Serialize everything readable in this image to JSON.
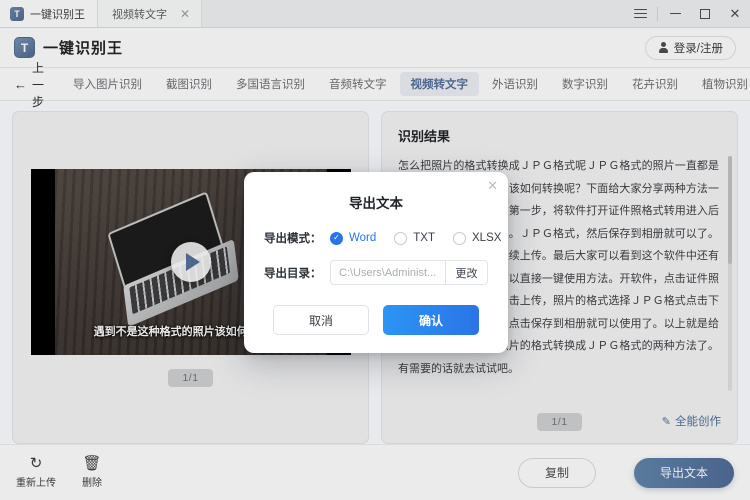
{
  "titlebar": {
    "app_name": "一键识别王",
    "logo_glyph": "T",
    "tab_label": "视频转文字",
    "tab_close": "✕",
    "menu_icon": "hamburger-menu-icon",
    "minimize_icon": "minimize-icon",
    "maximize_icon": "maximize-icon",
    "close_label": "✕"
  },
  "header": {
    "brand_name": "一键识别王",
    "logo_glyph": "T",
    "login_label": "登录/注册",
    "user_icon": "user-icon"
  },
  "nav": {
    "back_label": "上一步",
    "back_arrow": "←",
    "items": [
      {
        "label": "导入图片识别",
        "active": false
      },
      {
        "label": "截图识别",
        "active": false
      },
      {
        "label": "多国语言识别",
        "active": false
      },
      {
        "label": "音频转文字",
        "active": false
      },
      {
        "label": "视频转文字",
        "active": true
      },
      {
        "label": "外语识别",
        "active": false
      },
      {
        "label": "数字识别",
        "active": false
      },
      {
        "label": "花卉识别",
        "active": false
      },
      {
        "label": "植物识别",
        "active": false
      }
    ],
    "more_icon": "chevron-down-icon"
  },
  "preview": {
    "subtitle": "遇到不是这种格式的照片该如何转换呢?",
    "play_icon": "play-icon",
    "pager": "1/1"
  },
  "result": {
    "title": "识别结果",
    "text": "怎么把照片的格式转换成ＪＰＧ格式呢ＪＰＧ格式的照片一直都是我们最常使用的照片，该如何转换呢？下面给大家分享两种方法一证件照全能管家ＡＰＰ第一步，将软件打开证件照格式转用进入后就可以把照片添加进来。ＪＰＧ格式，然后保存到相册就可以了。想要继续转换的点击继续上传。最后大家可以看到这个软件中还有很多，大家需要的话可以直接一键使用方法。开软件，点击证件照格式转换。进入后，点击上传，照片的格式选择ＪＰＧ格式点击下一步就可以转换成功，点击保存到相册就可以使用了。以上就是给大家分享的，如何将照片的格式转换成ＪＰＧ格式的两种方法了。有需要的话就去试试吧。",
    "pager": "1/1",
    "create_label": "全能创作",
    "create_icon": "pen-icon"
  },
  "bottombar": {
    "reupload_label": "重新上传",
    "reupload_icon": "refresh-icon",
    "delete_label": "删除",
    "delete_icon": "trash-icon",
    "copy_label": "复制",
    "export_label": "导出文本"
  },
  "modal": {
    "title": "导出文本",
    "close_label": "✕",
    "mode_label": "导出模式：",
    "modes": [
      {
        "label": "Word",
        "selected": true,
        "check": "✓"
      },
      {
        "label": "TXT",
        "selected": false,
        "check": ""
      },
      {
        "label": "XLSX",
        "selected": false,
        "check": ""
      }
    ],
    "dir_label": "导出目录：",
    "dir_value": "C:\\Users\\Administ...",
    "dir_change_label": "更改",
    "cancel_label": "取消",
    "confirm_label": "确认"
  },
  "colors": {
    "accent": "#2b74e6",
    "accent_light": "#2b95f5",
    "nav_active_bg": "#e8f0fd",
    "panel_bg": "#f4f5f7",
    "page_bg": "#e9eaee"
  }
}
